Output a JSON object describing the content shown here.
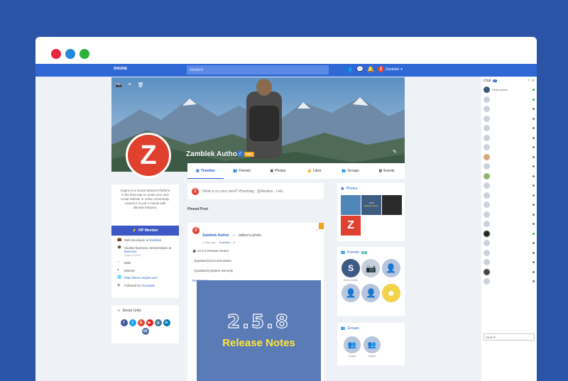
{
  "window": {
    "dot_colors": [
      "#e8263c",
      "#2787d8",
      "#2bb13b"
    ]
  },
  "topbar": {
    "brand": "SNGINE",
    "search_placeholder": "Search",
    "user_name": "Zamblek",
    "icons": [
      "people-icon",
      "chat-icon",
      "bell-icon"
    ]
  },
  "profile": {
    "name": "Zamblek Author",
    "pro_badge": "PRO",
    "initial": "Z",
    "tabs": [
      {
        "icon": "▤",
        "label": "Timeline"
      },
      {
        "icon": "👥",
        "label": "Friends"
      },
      {
        "icon": "▣",
        "label": "Photos"
      },
      {
        "icon": "👍",
        "label": "Likes"
      },
      {
        "icon": "👥",
        "label": "Groups"
      },
      {
        "icon": "▦",
        "label": "Events"
      }
    ]
  },
  "about": {
    "text": "Sngine is a Social Network Platform is the best way to create your own social website or online community. Launch it in just 1 minute with ultimate features.",
    "vip_label": "VIP Member",
    "info": {
      "work_prefix": "Web Developer at",
      "work_place": "Zamblek",
      "edu_prefix": "Studied Business Administration at",
      "edu_place": "Business",
      "edu_class": "Class of 2012",
      "gender": "Male",
      "relationship": "Married",
      "website": "https://demo.sngine.com",
      "followed_prefix": "Followed by",
      "followed_count": "20 people"
    }
  },
  "social": {
    "title": "Social Links",
    "icons": [
      {
        "name": "facebook-icon",
        "glyph": "f",
        "color": "#3b5998"
      },
      {
        "name": "twitter-icon",
        "glyph": "t",
        "color": "#1da1f2"
      },
      {
        "name": "google-icon",
        "glyph": "G",
        "color": "#dd4b39"
      },
      {
        "name": "youtube-icon",
        "glyph": "▶",
        "color": "#e62117"
      },
      {
        "name": "instagram-icon",
        "glyph": "◎",
        "color": "#3f729b"
      },
      {
        "name": "linkedin-icon",
        "glyph": "in",
        "color": "#0077b5"
      },
      {
        "name": "vk-icon",
        "glyph": "vk",
        "color": "#4c75a3"
      }
    ]
  },
  "composer": {
    "placeholder": "What is on your mind? #Hashtag.. @Mention.. Link.."
  },
  "pinned": {
    "label": "Pinned Post",
    "author": "Zamblek Author",
    "action": "added a photo",
    "time": "2 days ago",
    "translate": "Translate",
    "line1": "v2.5.8 Release Notes",
    "line2": "- [Updated] Documentation",
    "line3": "- [Updated] System Security",
    "read_more": "Read more",
    "image_version": "2.5.8",
    "image_label": "Release Notes"
  },
  "photos_card": {
    "title": "Photos",
    "colors": [
      "#4f86b8",
      "#3e5b80",
      "#2a2a2a",
      "#e0412f"
    ],
    "thumb_version": "2.5.8",
    "thumb_label": "Release Notes"
  },
  "friends_card": {
    "title": "Friends",
    "count": "70",
    "items": [
      "Demo Admin",
      "",
      "",
      "",
      "",
      ""
    ]
  },
  "groups_card": {
    "title": "Groups",
    "items": [
      "Sngine",
      "Sngine"
    ]
  },
  "chat": {
    "title": "Chat",
    "count": "0",
    "first_user": "Demo Admin",
    "search_placeholder": "Search"
  }
}
